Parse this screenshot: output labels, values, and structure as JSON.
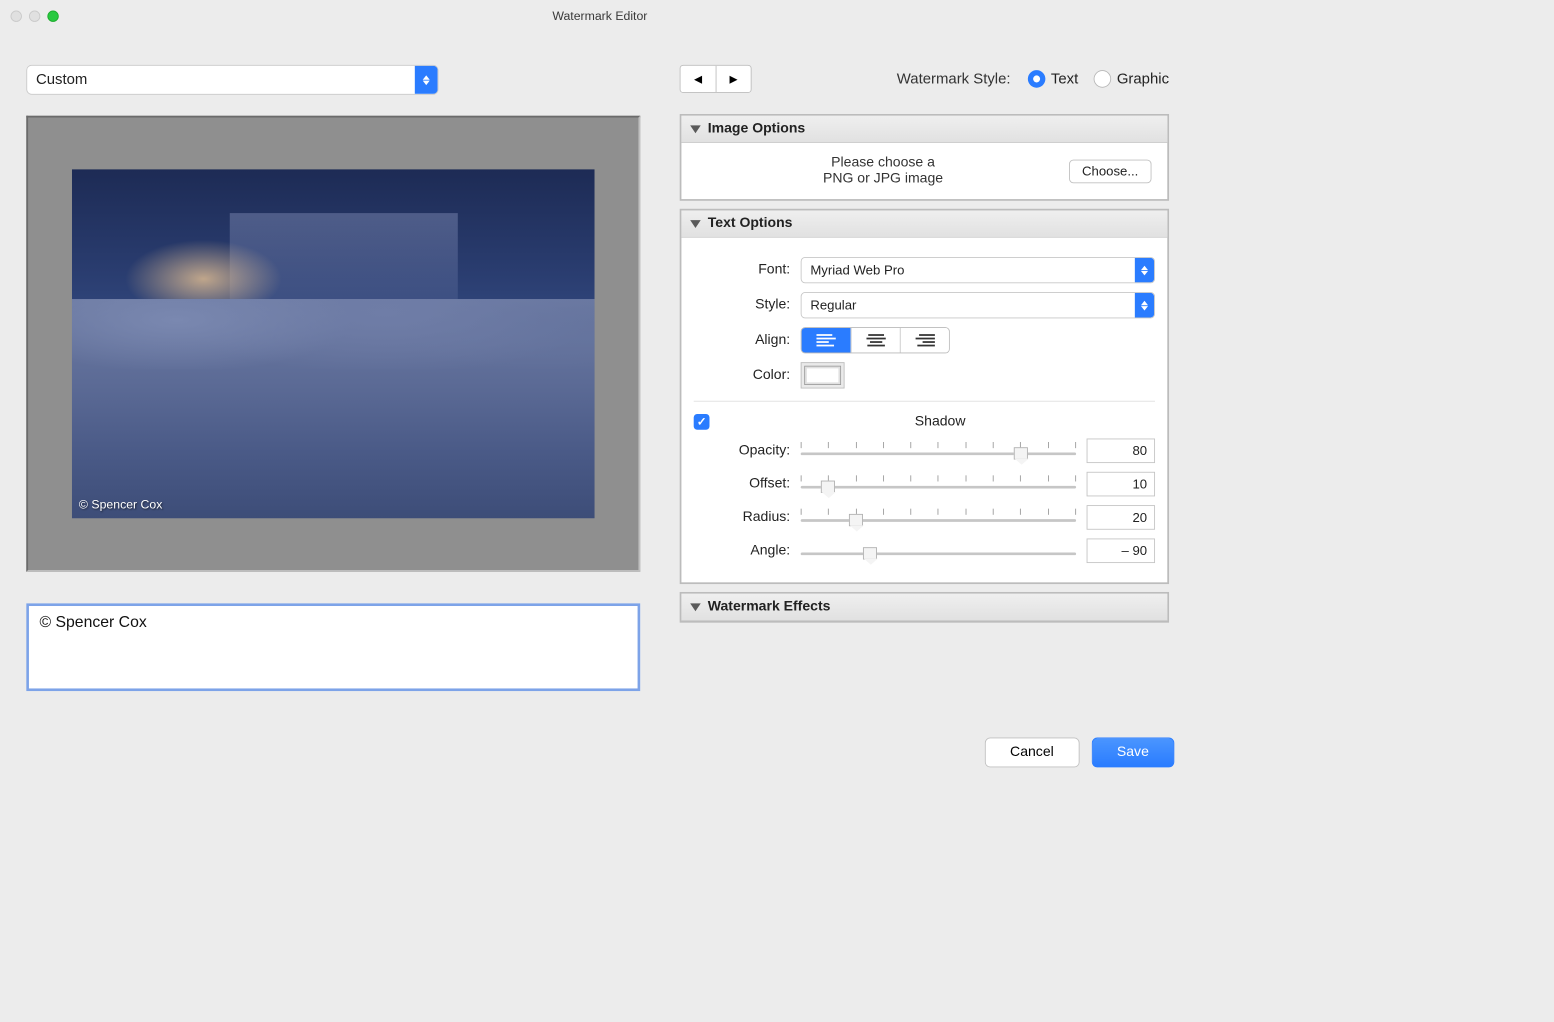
{
  "window": {
    "title": "Watermark Editor"
  },
  "preset": {
    "selected": "Custom"
  },
  "preview": {
    "watermark_on_photo": "© Spencer Cox"
  },
  "watermark_text": "© Spencer Cox",
  "style": {
    "label": "Watermark Style:",
    "text_label": "Text",
    "graphic_label": "Graphic",
    "value": "Text"
  },
  "panels": {
    "image_options": {
      "title": "Image Options",
      "hint_line1": "Please choose a",
      "hint_line2": "PNG or JPG image",
      "choose_label": "Choose..."
    },
    "text_options": {
      "title": "Text Options",
      "font_label": "Font:",
      "font_value": "Myriad Web Pro",
      "style_label": "Style:",
      "style_value": "Regular",
      "align_label": "Align:",
      "align_value": "left",
      "color_label": "Color:",
      "shadow_label": "Shadow",
      "shadow_checked": true,
      "opacity_label": "Opacity:",
      "opacity_value": "80",
      "offset_label": "Offset:",
      "offset_value": "10",
      "radius_label": "Radius:",
      "radius_value": "20",
      "angle_label": "Angle:",
      "angle_value": "– 90"
    },
    "watermark_effects": {
      "title": "Watermark Effects"
    }
  },
  "footer": {
    "cancel": "Cancel",
    "save": "Save"
  }
}
